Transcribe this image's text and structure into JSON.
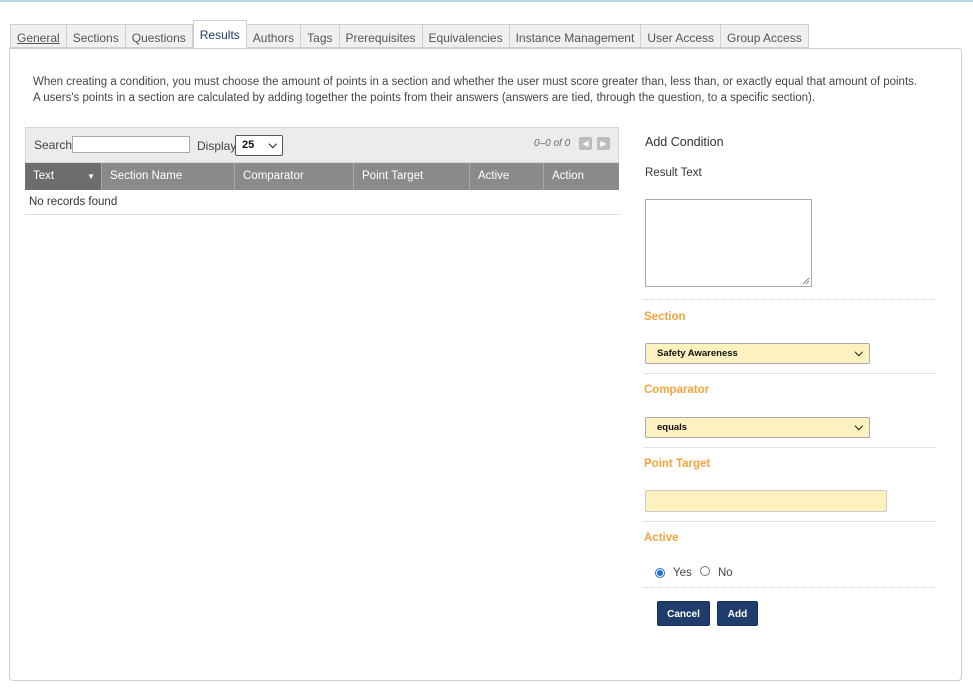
{
  "tabs": [
    {
      "label": "General"
    },
    {
      "label": "Sections"
    },
    {
      "label": "Questions"
    },
    {
      "label": "Results"
    },
    {
      "label": "Authors"
    },
    {
      "label": "Tags"
    },
    {
      "label": "Prerequisites"
    },
    {
      "label": "Equivalencies"
    },
    {
      "label": "Instance Management"
    },
    {
      "label": "User Access"
    },
    {
      "label": "Group Access"
    }
  ],
  "active_tab": "Results",
  "description": {
    "line1": "When creating a condition, you must choose the amount of points in a section and whether the user must score greater than, less than, or exactly equal that amount of points.",
    "line2": "A users's points in a section are calculated by adding together the points from their answers (answers are tied, through the question, to a specific section)."
  },
  "grid": {
    "search_label": "Search",
    "search_value": "",
    "display_label": "Display",
    "display_value": "25",
    "range_text": "0–0 of 0",
    "columns": [
      "Text",
      "Section Name",
      "Comparator",
      "Point Target",
      "Active",
      "Action"
    ],
    "sorted_column": "Text",
    "empty_text": "No records found"
  },
  "form": {
    "title": "Add Condition",
    "result_text_label": "Result Text",
    "result_text_value": "",
    "section_label": "Section",
    "section_value": "Safety Awareness",
    "comparator_label": "Comparator",
    "comparator_value": "equals",
    "point_target_label": "Point Target",
    "point_target_value": "",
    "active_label": "Active",
    "active_yes": "Yes",
    "active_no": "No",
    "active_selected": "Yes",
    "cancel_label": "Cancel",
    "add_label": "Add"
  },
  "colors": {
    "accent_orange": "#f4a33c",
    "button_navy": "#1f3d6b",
    "highlight_field": "#fdf1bf",
    "grid_header": "#8a8a8a"
  }
}
